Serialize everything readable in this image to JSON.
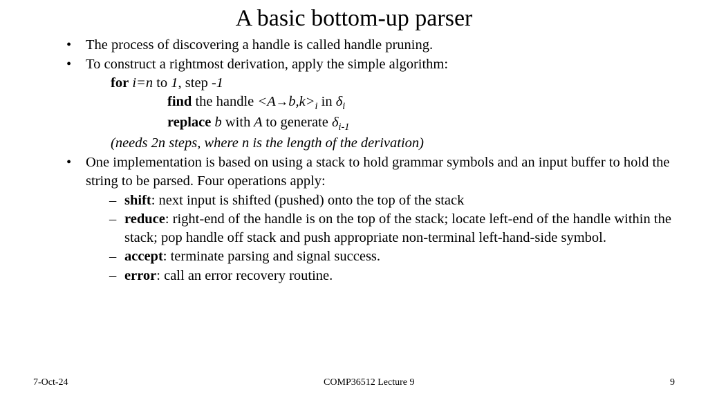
{
  "title": "A basic bottom-up parser",
  "bullets": {
    "b1": "The process of discovering a handle is called handle pruning.",
    "b2": "To construct a rightmost derivation, apply the simple algorithm:",
    "b3": "One implementation is based on using a stack to hold grammar symbols and an input buffer to hold the string to be parsed. Four operations apply:"
  },
  "algo": {
    "for": "for",
    "for_rest_1": " i=n ",
    "to": "to",
    "one": " 1",
    "step": ", step ",
    "neg1": "-1",
    "find": "find",
    "find_rest": " the handle ",
    "handle": "<A",
    "arrow": "→",
    "handle2": "b,k>",
    "sub_i": "i",
    "in": " in ",
    "delta": "δ",
    "replace": "replace",
    "b_sym": " b ",
    "with": "with",
    "A_sym": " A ",
    "togen": "to generate ",
    "sub_im1": "i-1",
    "note": "(needs 2n steps, where n is the length of the derivation)"
  },
  "ops": {
    "shift_b": "shift",
    "shift": ": next input is shifted (pushed) onto the top of the stack",
    "reduce_b": "reduce",
    "reduce": ": right-end of the handle is on the top of the stack; locate left-end of the handle within the stack; pop handle off stack and push appropriate non-terminal left-hand-side symbol.",
    "accept_b": "accept",
    "accept": ": terminate parsing and signal success.",
    "error_b": "error",
    "error": ": call an error recovery routine."
  },
  "footer": {
    "date": "7-Oct-24",
    "course": "COMP36512 Lecture 9",
    "page": "9"
  }
}
